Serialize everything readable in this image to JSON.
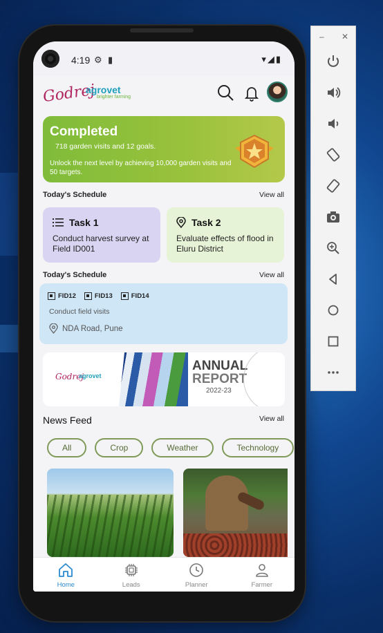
{
  "status_bar": {
    "time": "4:19"
  },
  "header": {
    "logo_brand": "Godrej",
    "logo_product": "agrovet",
    "logo_tagline": "brighter farming"
  },
  "hero": {
    "title": "Completed",
    "subtitle": "718 garden visits  and 12 goals.",
    "description": "Unlock the next level by achieving 10,000 garden visits and 50 targets."
  },
  "schedule1": {
    "title": "Today's Schedule",
    "view_all": "View all",
    "tasks": [
      {
        "title": "Task 1",
        "description": "Conduct harvest survey at Field ID001"
      },
      {
        "title": "Task 2",
        "description": "Evaluate effects of flood in Eluru District"
      }
    ]
  },
  "schedule2": {
    "title": "Today's Schedule",
    "view_all": "View all",
    "field_ids": [
      "FID12",
      "FID13",
      "FID14"
    ],
    "activity": "Conduct field visits",
    "location": "NDA Road, Pune"
  },
  "banner": {
    "brand": "Godrej",
    "product": "agrovet",
    "line1": "ANNUAL",
    "line2": "REPORT",
    "year": "2022-23"
  },
  "news": {
    "title": "News Feed",
    "view_all": "View all",
    "chips": [
      "All",
      "Crop",
      "Weather",
      "Technology"
    ]
  },
  "bottom_nav": [
    {
      "label": "Home",
      "icon": "home-icon",
      "active": true
    },
    {
      "label": "Leads",
      "icon": "chip-icon",
      "active": false
    },
    {
      "label": "Planner",
      "icon": "clock-icon",
      "active": false
    },
    {
      "label": "Farmer",
      "icon": "person-icon",
      "active": false
    }
  ],
  "colors": {
    "hero_green": "#8fbf3a",
    "task1_bg": "#d9d4f2",
    "task2_bg": "#e7f3d6",
    "field_card_bg": "#cfe6f7",
    "active_nav": "#2a8bd0",
    "chip_border": "#7f9a58"
  }
}
